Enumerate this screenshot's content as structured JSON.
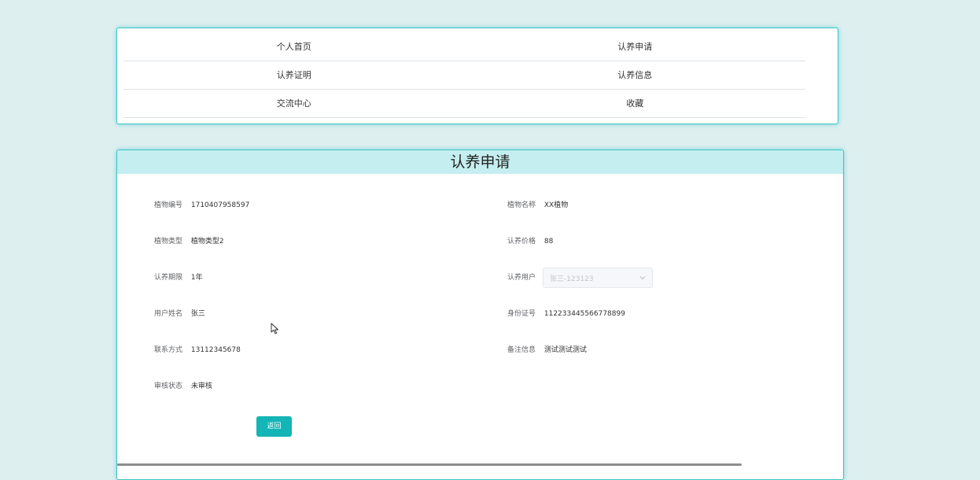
{
  "nav": {
    "items": [
      {
        "label": "个人首页"
      },
      {
        "label": "认养申请"
      },
      {
        "label": "认养证明"
      },
      {
        "label": "认养信息"
      },
      {
        "label": "交流中心"
      },
      {
        "label": "收藏"
      }
    ]
  },
  "page": {
    "title": "认养申请"
  },
  "form": {
    "plant_id_label": "植物编号",
    "plant_id_value": "1710407958597",
    "plant_name_label": "植物名称",
    "plant_name_value": "XX植物",
    "plant_type_label": "植物类型",
    "plant_type_value": "植物类型2",
    "price_label": "认养价格",
    "price_value": "88",
    "period_label": "认养期限",
    "period_value": "1年",
    "user_label": "认养用户",
    "user_select_value": "张三-123123",
    "name_label": "用户姓名",
    "name_value": "张三",
    "idcard_label": "身份证号",
    "idcard_value": "112233445566778899",
    "contact_label": "联系方式",
    "contact_value": "13112345678",
    "remark_label": "备注信息",
    "remark_value": "测试测试测试",
    "status_label": "审核状态",
    "status_value": "未审核",
    "back_label": "返回"
  },
  "colors": {
    "accent": "#14b5b6",
    "header_bg": "#c5eef0",
    "page_bg": "#deeff0"
  }
}
